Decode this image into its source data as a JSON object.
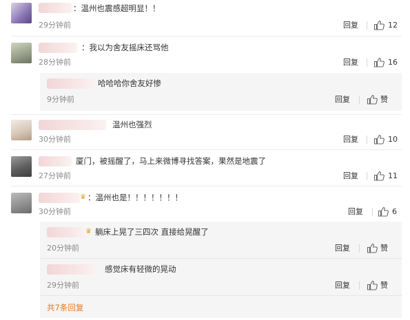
{
  "comments": [
    {
      "text": "：温州也震感超明显！！",
      "time": "29分钟前",
      "reply": "回复",
      "likes": "12"
    },
    {
      "text": "：我以为舍友摇床还骂他",
      "time": "28分钟前",
      "reply": "回复",
      "likes": "16"
    },
    {
      "text": "温州也强烈",
      "time": "30分钟前",
      "reply": "回复",
      "likes": "10"
    },
    {
      "text": "厦门，被摇醒了，马上来微博寻找答案，果然是地震了",
      "time": "27分钟前",
      "reply": "回复",
      "likes": "11"
    },
    {
      "text": "：温州也是！！！！！！！",
      "time": "30分钟前",
      "reply": "回复",
      "likes": "6"
    }
  ],
  "replies": [
    {
      "text": "哈哈哈你舍友好惨",
      "time": "9分钟前",
      "reply": "回复",
      "like": "赞"
    },
    {
      "text": "躺床上晃了三四次 直接给晃醒了",
      "time": "20分钟前",
      "reply": "回复",
      "like": "赞"
    },
    {
      "text": "感觉床有轻微的晃动",
      "time": "29分钟前",
      "reply": "回复",
      "like": "赞"
    }
  ],
  "more_replies": "共7条回复",
  "icons": {
    "like": "thumbs-up-icon"
  },
  "colors": {
    "link": "#e07b2a",
    "panel": "#f5f5f5",
    "muted": "#8a8a8a"
  }
}
